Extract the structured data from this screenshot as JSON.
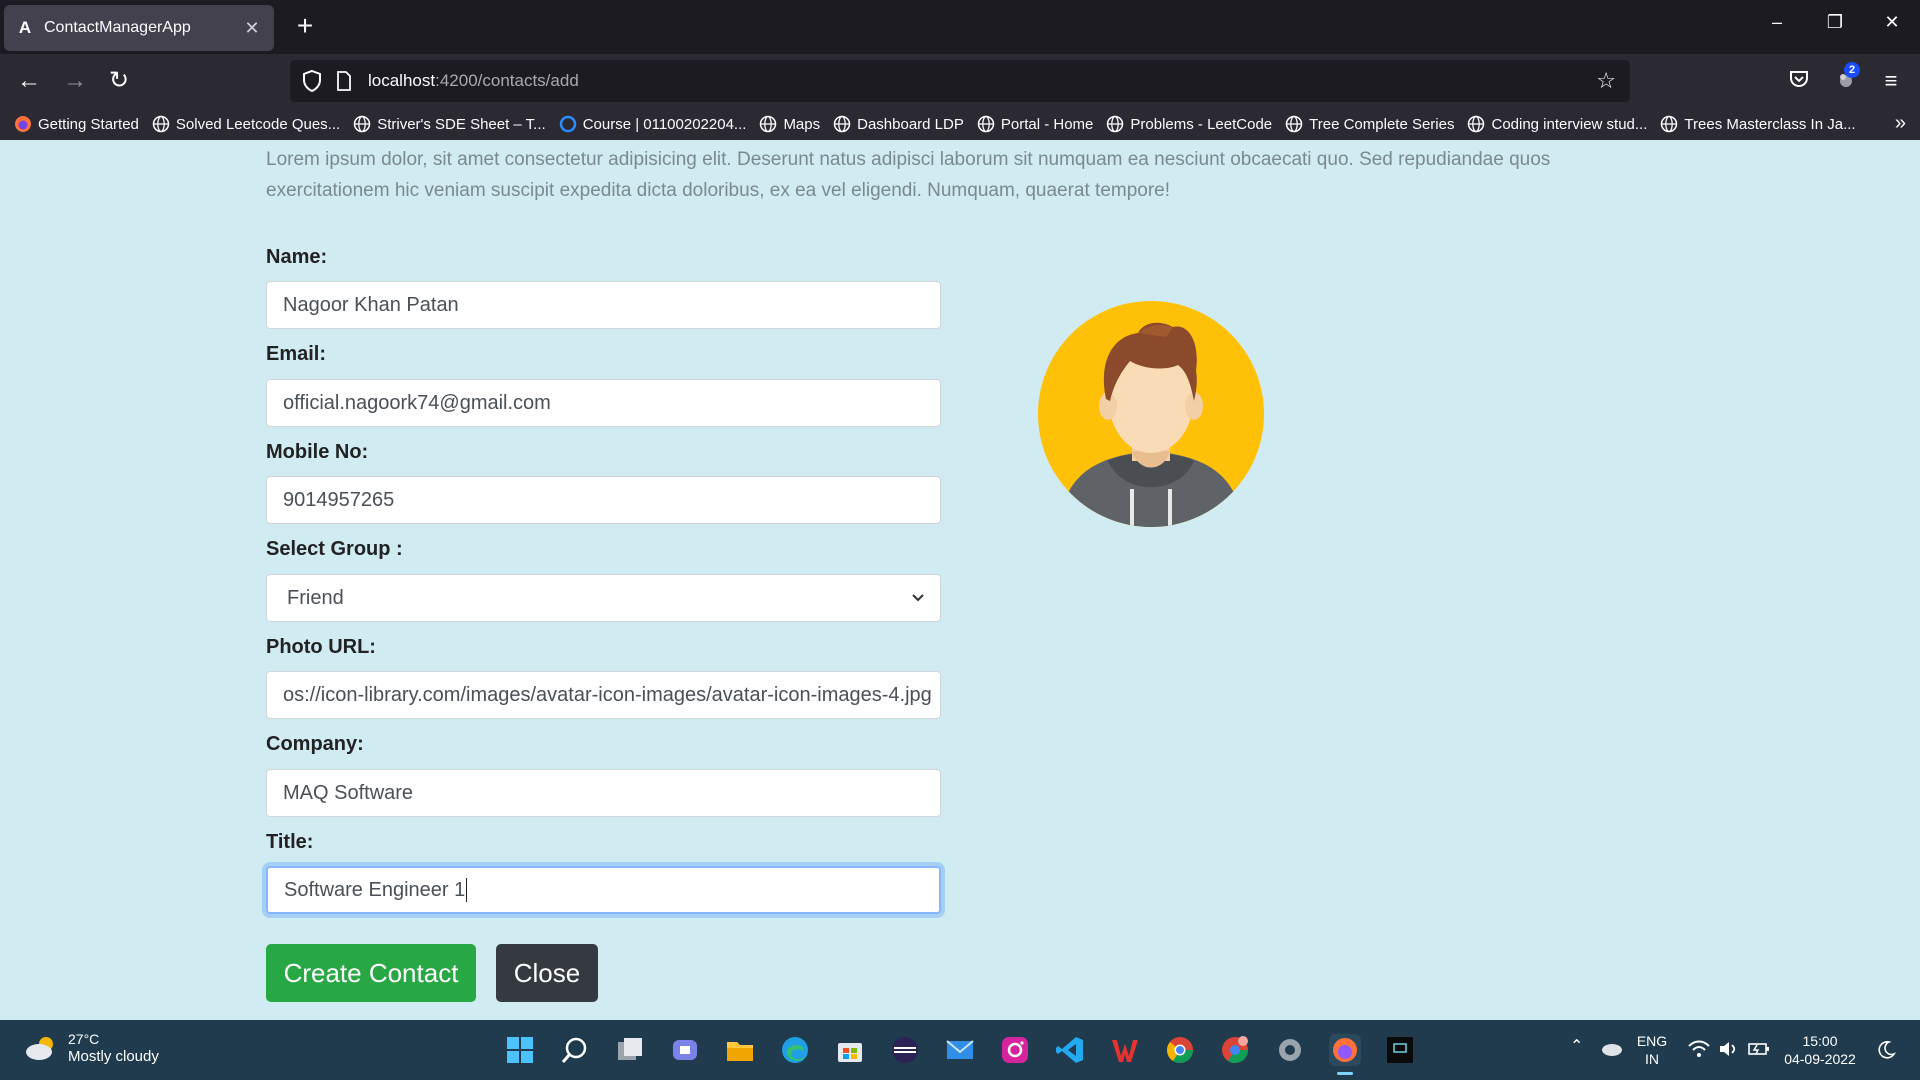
{
  "browser": {
    "tab_title": "ContactManagerApp",
    "tab_favicon": "A",
    "url_host": "localhost",
    "url_path": ":4200/contacts/add",
    "extension_badge": "2",
    "bookmarks": [
      "Getting Started",
      "Solved Leetcode Ques...",
      "Striver's SDE Sheet – T...",
      "Course | 01100202204...",
      "Maps",
      "Dashboard LDP",
      "Portal - Home",
      "Problems - LeetCode",
      "Tree Complete Series",
      "Coding interview stud...",
      "Trees Masterclass In Ja..."
    ]
  },
  "page": {
    "intro_text": "Lorem ipsum dolor, sit amet consectetur adipisicing elit. Deserunt natus adipisci laborum sit numquam ea nesciunt obcaecati quo. Sed repudiandae quos exercitationem hic veniam suscipit expedita dicta doloribus, ex ea vel eligendi. Numquam, quaerat tempore!",
    "form": {
      "name_label": "Name:",
      "name_value": "Nagoor Khan Patan",
      "email_label": "Email:",
      "email_value": "official.nagoork74@gmail.com",
      "mobile_label": "Mobile No:",
      "mobile_value": "9014957265",
      "group_label": "Select Group :",
      "group_value": "Friend",
      "photo_label": "Photo URL:",
      "photo_value": "os://icon-library.com/images/avatar-icon-images/avatar-icon-images-4.jpg",
      "company_label": "Company:",
      "company_value": "MAQ Software",
      "title_label": "Title:",
      "title_value": "Software Engineer 1"
    },
    "buttons": {
      "create": "Create Contact",
      "close": "Close"
    }
  },
  "taskbar": {
    "temperature": "27°C",
    "weather": "Mostly cloudy",
    "lang": "ENG",
    "region": "IN",
    "time": "15:00",
    "date": "04-09-2022"
  },
  "colors": {
    "page_bg": "#d1ebf2",
    "create_button": "#28a745",
    "close_button": "#343a40",
    "avatar_bg": "#ffc107"
  }
}
